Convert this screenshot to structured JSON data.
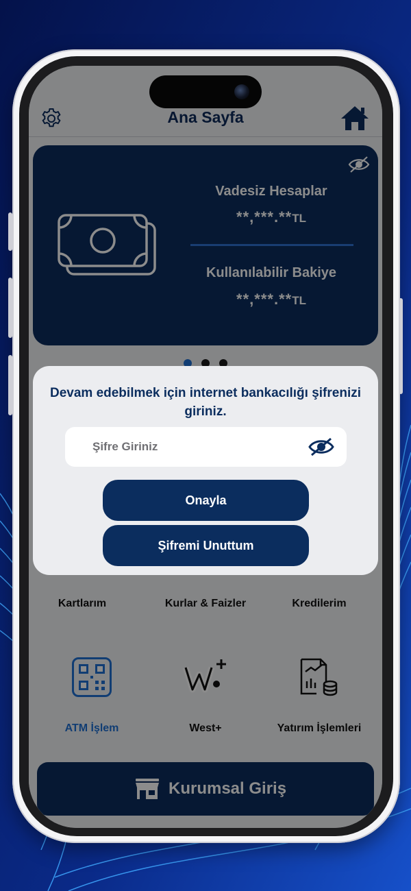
{
  "header": {
    "title": "Ana Sayfa",
    "settings_icon": "gear-icon",
    "home_icon": "home-icon"
  },
  "balance_card": {
    "eye_icon": "eye-slash-icon",
    "money_icon": "money-bills-icon",
    "accounts": [
      {
        "label": "Vadesiz Hesaplar",
        "amount": "**,***.**",
        "currency": "TL"
      },
      {
        "label": "Kullanılabilir Bakiye",
        "amount": "**,***.**",
        "currency": "TL"
      }
    ]
  },
  "pager": {
    "count": 3,
    "active_index": 0,
    "active_color": "#1f6fd1"
  },
  "modal": {
    "message": "Devam edebilmek için internet bankacılığı şifrenizi giriniz.",
    "password_placeholder": "Şifre Giriniz",
    "password_value": "",
    "confirm_label": "Onayla",
    "forgot_label": "Şifremi Unuttum"
  },
  "quick_links_row1": [
    {
      "label": "Kartlarım"
    },
    {
      "label": "Kurlar & Faizler"
    },
    {
      "label": "Kredilerim"
    }
  ],
  "quick_links_row2": [
    {
      "label": "ATM İşlem",
      "icon": "qr-code-icon",
      "color": "#1f6fd1"
    },
    {
      "label": "West+",
      "icon": "west-plus-icon",
      "color": "#111111"
    },
    {
      "label": "Yatırım İşlemleri",
      "icon": "investment-chart-icon",
      "color": "#111111"
    }
  ],
  "corporate": {
    "label": "Kurumsal Giriş",
    "icon": "storefront-icon"
  },
  "colors": {
    "primary": "#0b2d5e",
    "accent": "#1f6fd1",
    "background": "#061a5c"
  }
}
